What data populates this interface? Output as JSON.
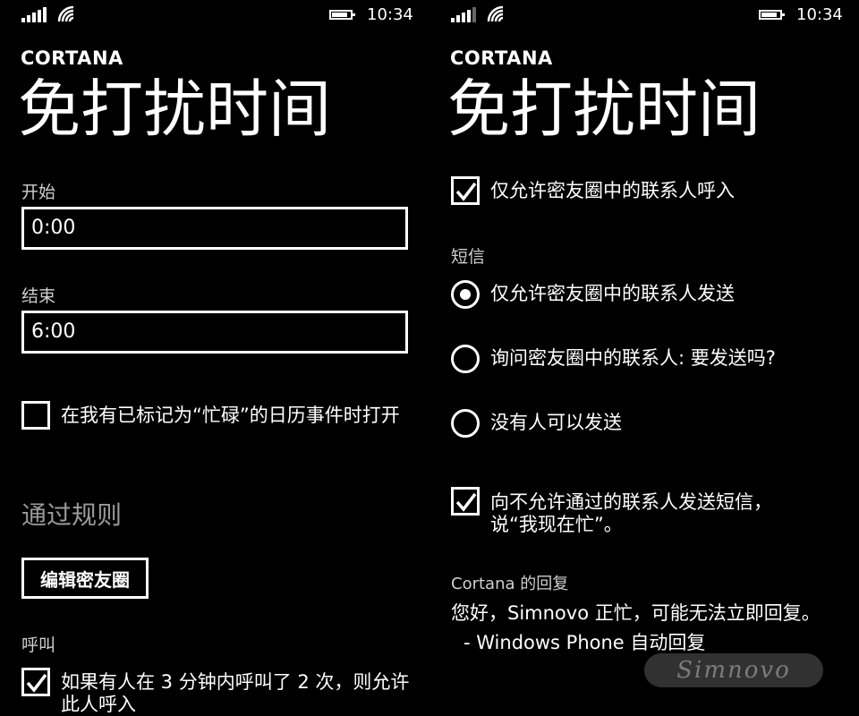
{
  "status": {
    "time": "10:34"
  },
  "left": {
    "app_title": "CORTANA",
    "page_title": "免打扰时间",
    "start_label": "开始",
    "start_value": "0:00",
    "end_label": "结束",
    "end_value": "6:00",
    "busy_option": "在我有已标记为“忙碌”的日历事件时打开",
    "busy_checked": false,
    "rules_header": "通过规则",
    "edit_button": "编辑密友圈",
    "calls_label": "呼叫",
    "repeat_call_option": "如果有人在 3 分钟内呼叫了 2 次，则允许此人呼入",
    "repeat_call_checked": true
  },
  "right": {
    "app_title": "CORTANA",
    "page_title": "免打扰时间",
    "inner_circle_calls": "仅允许密友圈中的联系人呼入",
    "inner_circle_calls_checked": true,
    "sms_label": "短信",
    "sms_options": [
      {
        "label": "仅允许密友圈中的联系人发送",
        "selected": true
      },
      {
        "label": "询问密友圈中的联系人: 要发送吗?",
        "selected": false
      },
      {
        "label": "没有人可以发送",
        "selected": false
      }
    ],
    "auto_reply_option": "向不允许通过的联系人发送短信，说“我现在忙”。",
    "auto_reply_checked": true,
    "reply_label": "Cortana 的回复",
    "reply_text": "您好，Simnovo 正忙，可能无法立即回复。",
    "reply_signature": "- Windows Phone 自动回复"
  },
  "watermark": "Simnovo",
  "colors": {
    "background": "#000000",
    "foreground": "#ffffff",
    "subtle": "#9a9a9a"
  },
  "icons": [
    "signal-icon",
    "wifi-icon",
    "battery-icon",
    "checkmark-icon"
  ]
}
